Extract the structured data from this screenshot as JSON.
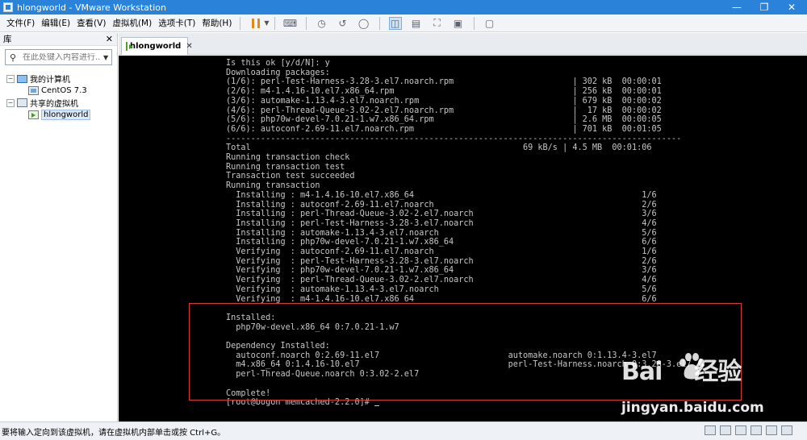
{
  "window": {
    "title": "hlongworld - VMware Workstation"
  },
  "menu": {
    "items": [
      {
        "label": "文件(F)"
      },
      {
        "label": "编辑(E)"
      },
      {
        "label": "查看(V)"
      },
      {
        "label": "虚拟机(M)"
      },
      {
        "label": "选项卡(T)"
      },
      {
        "label": "帮助(H)"
      }
    ]
  },
  "library": {
    "title": "库",
    "search_placeholder": "在此处键入内容进行...",
    "tree": [
      {
        "label": "我的计算机",
        "level": 0,
        "expanded": true
      },
      {
        "label": "CentOS 7.3",
        "level": 1
      },
      {
        "label": "共享的虚拟机",
        "level": 0,
        "expanded": true
      },
      {
        "label": "hlongworld",
        "level": 1,
        "selected": true
      }
    ]
  },
  "tab": {
    "label": "hlongworld"
  },
  "console": {
    "lines": [
      "Is this ok [y/d/N]: y",
      "Downloading packages:",
      "(1/6): perl-Test-Harness-3.28-3.el7.noarch.rpm                        | 302 kB  00:00:01",
      "(2/6): m4-1.4.16-10.el7.x86_64.rpm                                    | 256 kB  00:00:01",
      "(3/6): automake-1.13.4-3.el7.noarch.rpm                               | 679 kB  00:00:02",
      "(4/6): perl-Thread-Queue-3.02-2.el7.noarch.rpm                        |  17 kB  00:00:02",
      "(5/6): php70w-devel-7.0.21-1.w7.x86_64.rpm                            | 2.6 MB  00:00:05",
      "(6/6): autoconf-2.69-11.el7.noarch.rpm                                | 701 kB  00:01:05",
      "--------------------------------------------------------------------------------------------",
      "Total                                                       69 kB/s | 4.5 MB  00:01:06",
      "Running transaction check",
      "Running transaction test",
      "Transaction test succeeded",
      "Running transaction",
      "  Installing : m4-1.4.16-10.el7.x86_64                                              1/6",
      "  Installing : autoconf-2.69-11.el7.noarch                                          2/6",
      "  Installing : perl-Thread-Queue-3.02-2.el7.noarch                                  3/6",
      "  Installing : perl-Test-Harness-3.28-3.el7.noarch                                  4/6",
      "  Installing : automake-1.13.4-3.el7.noarch                                         5/6",
      "  Installing : php70w-devel-7.0.21-1.w7.x86_64                                      6/6",
      "  Verifying  : autoconf-2.69-11.el7.noarch                                          1/6",
      "  Verifying  : perl-Test-Harness-3.28-3.el7.noarch                                  2/6",
      "  Verifying  : php70w-devel-7.0.21-1.w7.x86_64                                      3/6",
      "  Verifying  : perl-Thread-Queue-3.02-2.el7.noarch                                  4/6",
      "  Verifying  : automake-1.13.4-3.el7.noarch                                         5/6",
      "  Verifying  : m4-1.4.16-10.el7.x86_64                                              6/6",
      "",
      "Installed:",
      "  php70w-devel.x86_64 0:7.0.21-1.w7",
      "",
      "Dependency Installed:",
      "  autoconf.noarch 0:2.69-11.el7                          automake.noarch 0:1.13.4-3.el7",
      "  m4.x86_64 0:1.4.16-10.el7                              perl-Test-Harness.noarch 0:3.28-3.el7",
      "  perl-Thread-Queue.noarch 0:3.02-2.el7",
      "",
      "Complete!",
      "[root@bogon memcached-2.2.0]# "
    ]
  },
  "status": {
    "text": "要将输入定向到该虚拟机，请在虚拟机内部单击或按 Ctrl+G。"
  },
  "watermark": {
    "logo_text": "Bai",
    "logo_suffix": "经验",
    "url": "jingyan.baidu.com"
  },
  "colors": {
    "titlebar": "#2b82d9",
    "console_bg": "#000000",
    "console_text": "#c7c7c7",
    "highlight": "#d43b3b"
  }
}
